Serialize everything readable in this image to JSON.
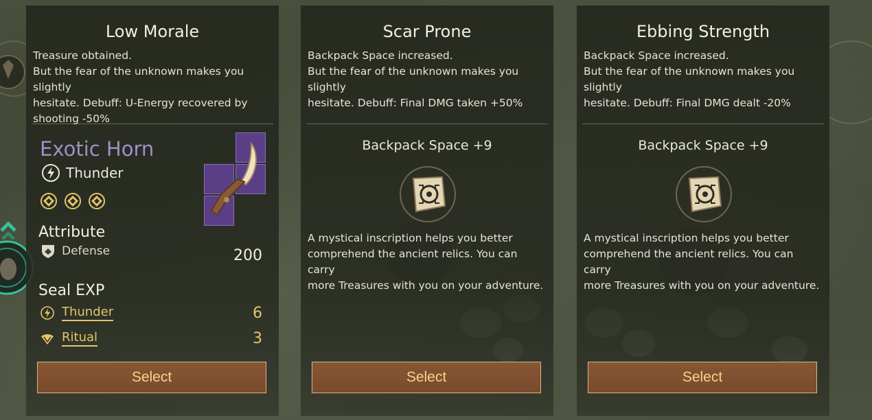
{
  "cards": [
    {
      "title": "Low Morale",
      "desc_lines": [
        "Treasure obtained.",
        "But the fear of the unknown makes you slightly",
        "hesitate. Debuff: U-Energy recovered by",
        "shooting -50%"
      ],
      "item_name": "Exotic Horn",
      "element": "Thunder",
      "attribute_title": "Attribute",
      "attribute": {
        "label": "Defense",
        "value": "200"
      },
      "seal_title": "Seal EXP",
      "seal_exp": [
        {
          "label": "Thunder",
          "value": "6",
          "icon": "thunder-icon"
        },
        {
          "label": "Ritual",
          "value": "3",
          "icon": "ritual-icon"
        }
      ],
      "button": "Select"
    },
    {
      "title": "Scar Prone",
      "desc_lines": [
        "Backpack Space increased.",
        "But the fear of the unknown makes you slightly",
        "hesitate. Debuff: Final DMG taken +50%"
      ],
      "bonus": "Backpack Space +9",
      "lore_lines": [
        "A mystical inscription helps you better",
        "comprehend the ancient relics. You can carry",
        "more Treasures with you on your adventure."
      ],
      "button": "Select"
    },
    {
      "title": "Ebbing Strength",
      "desc_lines": [
        "Backpack Space increased.",
        "But the fear of the unknown makes you slightly",
        "hesitate. Debuff: Final DMG dealt -20%"
      ],
      "bonus": "Backpack Space +9",
      "lore_lines": [
        "A mystical inscription helps you better",
        "comprehend the ancient relics. You can carry",
        "more Treasures with you on your adventure."
      ],
      "button": "Select"
    }
  ],
  "colors": {
    "item_name": "#9f8fc7",
    "seal_exp": "#e6c56a",
    "button_bg": "#7f5030",
    "button_text": "#f4d58a"
  }
}
